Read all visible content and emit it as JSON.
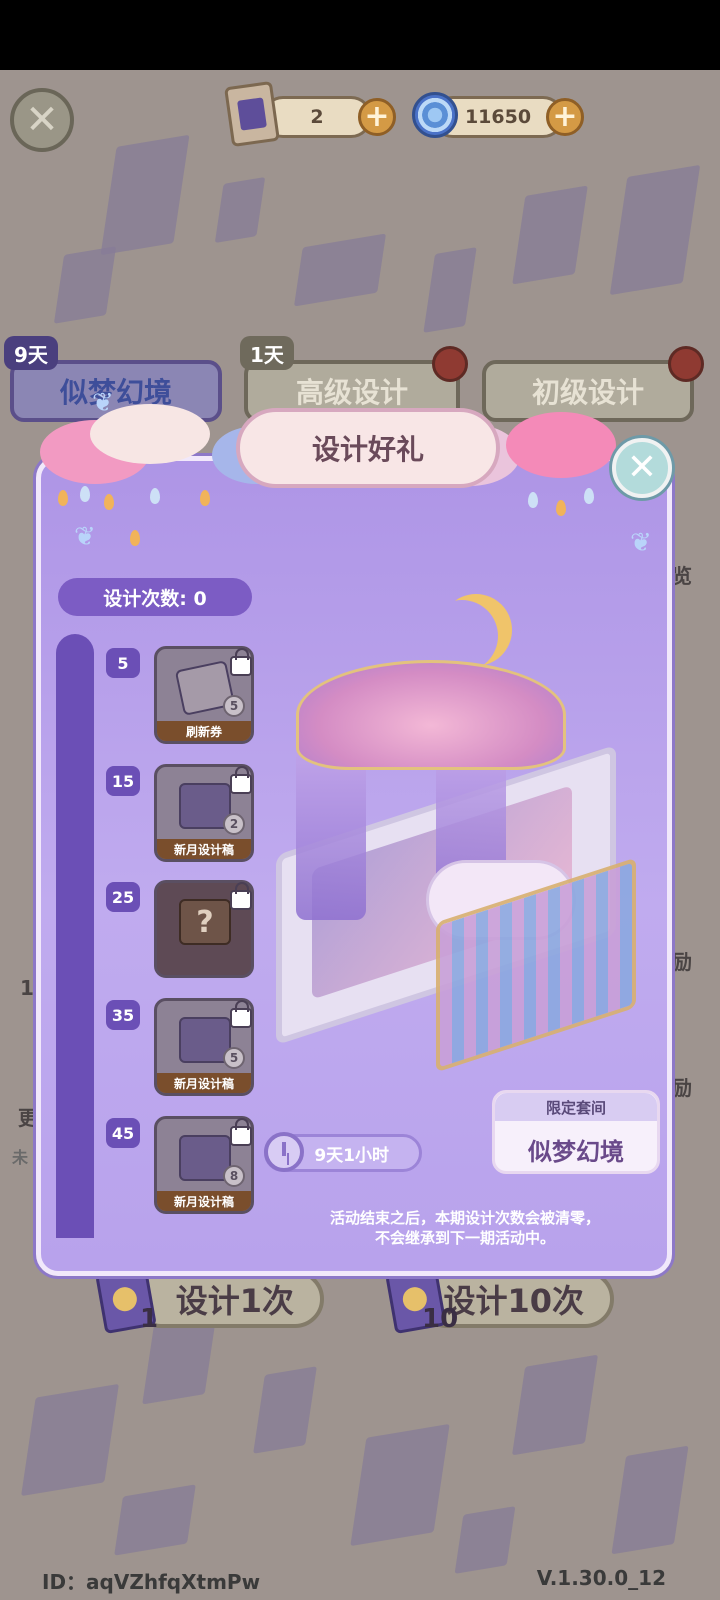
{
  "currency": {
    "scroll_count": "2",
    "swirl_count": "11650"
  },
  "tabs": {
    "dream": {
      "label": "似梦幻境",
      "badge": "9天"
    },
    "advanced": {
      "label": "高级设计",
      "badge": "1天"
    },
    "basic": {
      "label": "初级设计"
    }
  },
  "popup": {
    "title": "设计好礼",
    "design_count_label": "设计次数: 0",
    "tiers": [
      {
        "threshold": "5",
        "reward_label": "刷新券",
        "qty": "5",
        "icon": "refresh-ticket-icon"
      },
      {
        "threshold": "15",
        "reward_label": "新月设计稿",
        "qty": "2",
        "icon": "new-moon-draft-icon"
      },
      {
        "threshold": "25",
        "reward_label": "",
        "qty": "",
        "icon": "mystery-box-icon"
      },
      {
        "threshold": "35",
        "reward_label": "新月设计稿",
        "qty": "5",
        "icon": "new-moon-draft-icon"
      },
      {
        "threshold": "45",
        "reward_label": "新月设计稿",
        "qty": "8",
        "icon": "new-moon-draft-icon"
      }
    ],
    "timer": "9天1小时",
    "limited_label": "限定套间",
    "limited_name": "似梦幻境",
    "note_line1": "活动结束之后，本期设计次数会被清零，",
    "note_line2": "不会继承到下一期活动中。"
  },
  "side": {
    "right_1": "览",
    "right_2": "励",
    "right_3": "励",
    "left_1": "1",
    "left_2": "更",
    "left_3": "未"
  },
  "bottom": {
    "design_1_label": "设计1次",
    "design_1_count": "1",
    "design_10_label": "设计10次",
    "design_10_count": "10"
  },
  "footer": {
    "id": "ID：aqVZhfqXtmPw",
    "version": "V.1.30.0_12"
  },
  "colors": {
    "popup_bg": "#b8a2ec",
    "accent_purple": "#6b4fb6",
    "plus_orange": "#d49a45"
  }
}
